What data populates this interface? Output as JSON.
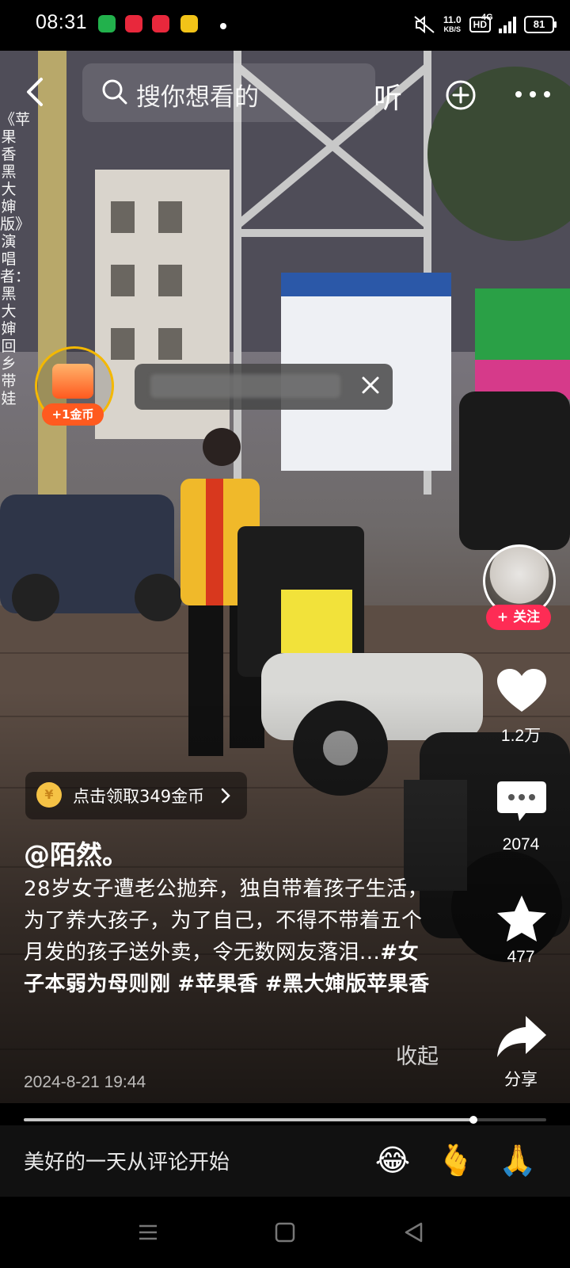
{
  "status_bar": {
    "time": "08:31",
    "net_speed": "11.0",
    "net_unit": "KB/S",
    "hd": "HD",
    "signal": "4G",
    "battery": "81",
    "app_icons": [
      {
        "name": "message-app-icon",
        "color": "#22b14c"
      },
      {
        "name": "health-app-icon",
        "color": "#e8283c"
      },
      {
        "name": "toutiao-app-icon",
        "color": "#e8283c"
      },
      {
        "name": "notes-app-icon",
        "color": "#f2c318"
      }
    ]
  },
  "header": {
    "search_placeholder": "搜你想看的",
    "listen_label": "听"
  },
  "video_overlay": {
    "vertical_title": "《苹果香黑大婶版》演唱者：黑大婶回乡带娃",
    "coin_widget_label": "+1金币"
  },
  "actions": {
    "like_count": "1.2万",
    "comment_count": "2074",
    "favorite_count": "477",
    "share_label": "分享",
    "follow_label": "+ 关注",
    "accent_color": "#fe2c55"
  },
  "reward": {
    "coin_symbol": "¥",
    "text": "点击领取349金币"
  },
  "post": {
    "author": "@陌然。",
    "description": "28岁女子遭老公抛弃，独自带着孩子生活，为了养大孩子，为了自己，不得不带着五个月发的孩子送外卖，令无数网友落泪...",
    "hashtags": [
      "#女子本弱为母则刚",
      "#苹果香",
      "#黑大婶版苹果香"
    ],
    "collapse_label": "收起",
    "date": "2024-8-21 19:44",
    "progress": 0.86
  },
  "comment_bar": {
    "placeholder": "美好的一天从评论开始",
    "emojis": [
      "😂",
      "🫰",
      "🙏"
    ]
  }
}
